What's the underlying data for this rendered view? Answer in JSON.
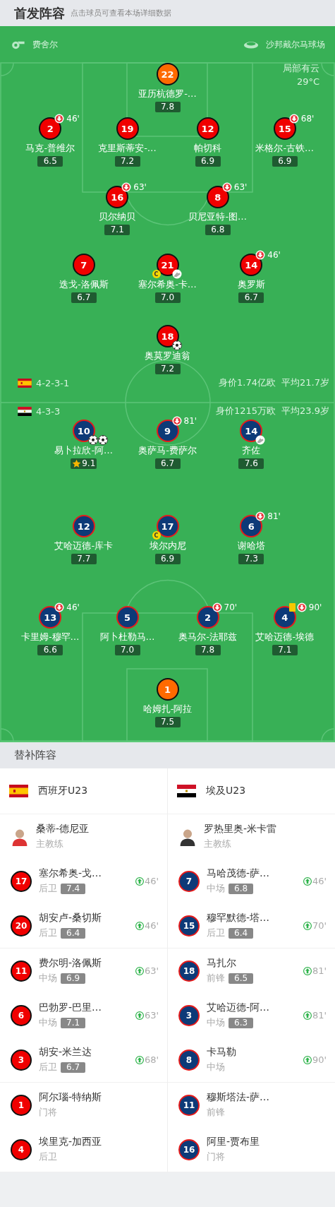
{
  "header": {
    "title": "首发阵容",
    "hint": "点击球员可查看本场详细数据"
  },
  "match": {
    "referee": "费舍尔",
    "stadium": "沙邦戴尔马球场",
    "weather": "局部有云",
    "temperature": "29°C"
  },
  "home": {
    "kind": "home",
    "flag": {
      "kind": "spain"
    },
    "formation": "4-2-3-1",
    "value": "身价1.74亿欧",
    "age": "平均21.7岁",
    "lines": [
      [
        {
          "number": "22",
          "name": "亚历杭德罗-…",
          "rating": "7.8",
          "kind": "keeper",
          "mvp": false
        }
      ],
      [
        {
          "number": "2",
          "name": "马克-普维尔",
          "rating": "6.5",
          "kind": "field",
          "mvp": false,
          "subbed_off": "46'"
        },
        {
          "number": "19",
          "name": "克里斯蒂安-…",
          "rating": "7.2",
          "kind": "field",
          "mvp": false
        },
        {
          "number": "12",
          "name": "帕切科",
          "rating": "6.9",
          "kind": "field",
          "mvp": false
        },
        {
          "number": "15",
          "name": "米格尔-古铁…",
          "rating": "6.9",
          "kind": "field",
          "mvp": false,
          "subbed_off": "68'"
        }
      ],
      [
        {
          "number": "16",
          "name": "贝尔纳贝",
          "rating": "7.1",
          "kind": "field",
          "mvp": false,
          "subbed_off": "63'"
        },
        {
          "number": "8",
          "name": "贝尼亚特-图…",
          "rating": "6.8",
          "kind": "field",
          "mvp": false,
          "subbed_off": "63'"
        }
      ],
      [
        {
          "number": "7",
          "name": "迭戈-洛佩斯",
          "rating": "6.7",
          "kind": "field",
          "mvp": false
        },
        {
          "number": "21",
          "name": "塞尔希奥-卡…",
          "rating": "7.0",
          "kind": "field",
          "mvp": false,
          "badge": "C",
          "events": [
            {
              "kind": "assist"
            }
          ]
        },
        {
          "number": "14",
          "name": "奥罗斯",
          "rating": "6.7",
          "kind": "field",
          "mvp": false,
          "subbed_off": "46'"
        }
      ],
      [
        {
          "number": "18",
          "name": "奥莫罗迪翁",
          "rating": "7.2",
          "kind": "field",
          "mvp": false,
          "events": [
            {
              "kind": "goal"
            }
          ]
        }
      ]
    ]
  },
  "away": {
    "kind": "away",
    "flag": {
      "kind": "egypt"
    },
    "formation": "4-3-3",
    "value": "身价1215万欧",
    "age": "平均23.9岁",
    "lines": [
      [
        {
          "number": "10",
          "name": "易卜拉欣-阿…",
          "rating": "9.1",
          "kind": "field",
          "mvp": true,
          "events": [
            {
              "kind": "goal"
            },
            {
              "kind": "goal"
            }
          ]
        },
        {
          "number": "9",
          "name": "奥萨马-费萨尔",
          "rating": "6.7",
          "kind": "field",
          "mvp": false,
          "subbed_off": "81'"
        },
        {
          "number": "14",
          "name": "齐佐",
          "rating": "7.6",
          "kind": "field",
          "mvp": false,
          "events": [
            {
              "kind": "assist"
            }
          ]
        }
      ],
      [
        {
          "number": "12",
          "name": "艾哈迈德-库卡",
          "rating": "7.7",
          "kind": "field",
          "mvp": false
        },
        {
          "number": "17",
          "name": "埃尔内尼",
          "rating": "6.9",
          "kind": "field",
          "mvp": false,
          "badge": "C"
        },
        {
          "number": "6",
          "name": "谢哈塔",
          "rating": "7.3",
          "kind": "field",
          "mvp": false,
          "subbed_off": "81'"
        }
      ],
      [
        {
          "number": "13",
          "name": "卡里姆-穆罕…",
          "rating": "6.6",
          "kind": "field",
          "mvp": false,
          "subbed_off": "46'"
        },
        {
          "number": "5",
          "name": "阿卜杜勒马…",
          "rating": "7.0",
          "kind": "field",
          "mvp": false
        },
        {
          "number": "2",
          "name": "奥马尔-法耶兹",
          "rating": "7.8",
          "kind": "field",
          "mvp": false,
          "subbed_off": "70'"
        },
        {
          "number": "4",
          "name": "艾哈迈德-埃德",
          "rating": "7.1",
          "kind": "field",
          "mvp": false,
          "subbed_off": "90'",
          "events": [
            {
              "kind": "yellow_card"
            }
          ]
        }
      ],
      [
        {
          "number": "1",
          "name": "哈姆扎-阿拉",
          "rating": "7.5",
          "kind": "keeper",
          "mvp": false
        }
      ]
    ]
  },
  "bench": {
    "title": "替补阵容",
    "columns": [
      {
        "kind": "home",
        "flag": {
          "kind": "spain"
        },
        "team": "西班牙U23",
        "groups": [
          [
            {
              "kind": "coach",
              "name": "桑蒂-德尼亚",
              "role": "主教练"
            },
            {
              "kind": "player",
              "number": "17",
              "name": "塞尔希奥-戈…",
              "position": "后卫",
              "rating": "7.4",
              "subbed_on": "46'"
            },
            {
              "kind": "player",
              "number": "20",
              "name": "胡安卢-桑切斯",
              "position": "后卫",
              "rating": "6.4",
              "subbed_on": "46'"
            }
          ],
          [
            {
              "kind": "player",
              "number": "11",
              "name": "费尔明-洛佩斯",
              "position": "中场",
              "rating": "6.9",
              "subbed_on": "63'"
            },
            {
              "kind": "player",
              "number": "6",
              "name": "巴勃罗-巴里…",
              "position": "中场",
              "rating": "7.1",
              "subbed_on": "63'"
            },
            {
              "kind": "player",
              "number": "3",
              "name": "胡安-米兰达",
              "position": "后卫",
              "rating": "6.7",
              "subbed_on": "68'"
            }
          ],
          [
            {
              "kind": "player",
              "number": "1",
              "name": "阿尔瑙-特纳斯",
              "position": "门将"
            },
            {
              "kind": "player",
              "number": "4",
              "name": "埃里克-加西亚",
              "position": "后卫"
            }
          ]
        ]
      },
      {
        "kind": "away",
        "flag": {
          "kind": "egypt"
        },
        "team": "埃及U23",
        "groups": [
          [
            {
              "kind": "coach",
              "name": "罗热里奥-米卡雷",
              "role": "主教练"
            },
            {
              "kind": "player",
              "number": "7",
              "name": "马哈茂德-萨…",
              "position": "中场",
              "rating": "6.8",
              "subbed_on": "46'"
            },
            {
              "kind": "player",
              "number": "15",
              "name": "穆罕默德-塔…",
              "position": "后卫",
              "rating": "6.4",
              "subbed_on": "70'"
            }
          ],
          [
            {
              "kind": "player",
              "number": "18",
              "name": "马扎尔",
              "position": "前锋",
              "rating": "6.5",
              "subbed_on": "81'"
            },
            {
              "kind": "player",
              "number": "3",
              "name": "艾哈迈德-阿…",
              "position": "中场",
              "rating": "6.3",
              "subbed_on": "81'"
            },
            {
              "kind": "player",
              "number": "8",
              "name": "卡马勒",
              "position": "中场",
              "subbed_on": "90'"
            }
          ],
          [
            {
              "kind": "player",
              "number": "11",
              "name": "穆斯塔法-萨…",
              "position": "前锋"
            },
            {
              "kind": "player",
              "number": "16",
              "name": "阿里-贾布里",
              "position": "门将"
            }
          ]
        ]
      }
    ]
  }
}
